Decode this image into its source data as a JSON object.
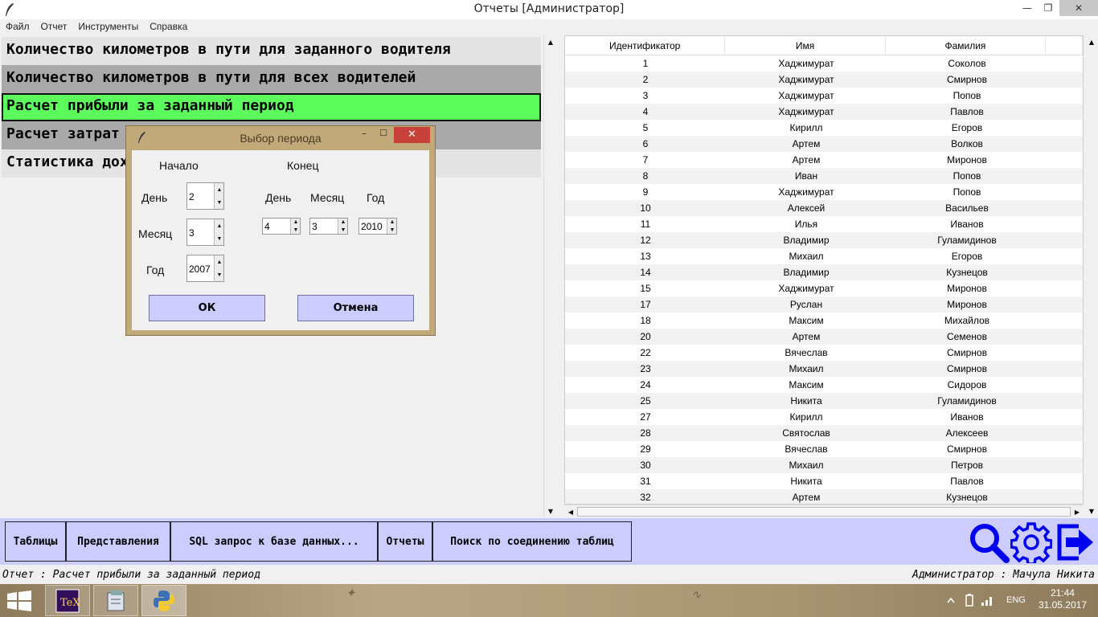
{
  "window": {
    "title": "Отчеты [Администратор]",
    "minimize_glyph": "—",
    "maximize_glyph": "❐",
    "close_glyph": "✕"
  },
  "menu": [
    "Файл",
    "Отчет",
    "Инструменты",
    "Справка"
  ],
  "reports": [
    {
      "label": "Количество километров в пути для заданного водителя",
      "state": "light"
    },
    {
      "label": "Количество километров в пути для всех водителей",
      "state": "dark"
    },
    {
      "label": "Расчет прибыли за заданный период",
      "state": "active"
    },
    {
      "label": "Расчет затрат на ремонт за заданный период",
      "state": "dark"
    },
    {
      "label": "Статистика доходов по водителям за все время",
      "state": "light"
    }
  ],
  "dialog": {
    "title": "Выбор периода",
    "min_glyph": "–",
    "max_glyph": "☐",
    "close_glyph": "✕",
    "start_label": "Начало",
    "end_label": "Конец",
    "day_label": "День",
    "month_label": "Месяц",
    "year_label": "Год",
    "start": {
      "day": "2",
      "month": "3",
      "year": "2007"
    },
    "end": {
      "day": "4",
      "month": "3",
      "year": "2010"
    },
    "ok_label": "ОК",
    "cancel_label": "Отмена"
  },
  "table": {
    "columns": [
      "Идентификатор",
      "Имя",
      "Фамилия"
    ],
    "rows": [
      [
        "1",
        "Хаджимурат",
        "Соколов"
      ],
      [
        "2",
        "Хаджимурат",
        "Смирнов"
      ],
      [
        "3",
        "Хаджимурат",
        "Попов"
      ],
      [
        "4",
        "Хаджимурат",
        "Павлов"
      ],
      [
        "5",
        "Кирилл",
        "Егоров"
      ],
      [
        "6",
        "Артем",
        "Волков"
      ],
      [
        "7",
        "Артем",
        "Миронов"
      ],
      [
        "8",
        "Иван",
        "Попов"
      ],
      [
        "9",
        "Хаджимурат",
        "Попов"
      ],
      [
        "10",
        "Алексей",
        "Васильев"
      ],
      [
        "11",
        "Илья",
        "Иванов"
      ],
      [
        "12",
        "Владимир",
        "Гуламидинов"
      ],
      [
        "13",
        "Михаил",
        "Егоров"
      ],
      [
        "14",
        "Владимир",
        "Кузнецов"
      ],
      [
        "15",
        "Хаджимурат",
        "Миронов"
      ],
      [
        "17",
        "Руслан",
        "Миронов"
      ],
      [
        "18",
        "Максим",
        "Михайлов"
      ],
      [
        "20",
        "Артем",
        "Семенов"
      ],
      [
        "22",
        "Вячеслав",
        "Смирнов"
      ],
      [
        "23",
        "Михаил",
        "Смирнов"
      ],
      [
        "24",
        "Максим",
        "Сидоров"
      ],
      [
        "25",
        "Никита",
        "Гуламидинов"
      ],
      [
        "27",
        "Кирилл",
        "Иванов"
      ],
      [
        "28",
        "Святослав",
        "Алексеев"
      ],
      [
        "29",
        "Вячеслав",
        "Смирнов"
      ],
      [
        "30",
        "Михаил",
        "Петров"
      ],
      [
        "31",
        "Никита",
        "Павлов"
      ],
      [
        "32",
        "Артем",
        "Кузнецов"
      ]
    ]
  },
  "toolbar": {
    "buttons": [
      "Таблицы",
      "Представления",
      "SQL запрос к базе данных...",
      "Отчеты",
      "Поиск по соединению таблиц"
    ],
    "icons": [
      "search-icon",
      "settings-gear-icon",
      "exit-icon"
    ],
    "icon_color": "#0000ee"
  },
  "status": {
    "left": "Отчет : Расчет прибыли за заданный период",
    "right": "Администратор : Мачула Никита"
  },
  "taskbar": {
    "time": "21:44",
    "date": "31.05.2017",
    "lang": "ENG",
    "apps": [
      "texworks-icon",
      "file-manager-icon",
      "python-icon"
    ]
  },
  "colors": {
    "active_report": "#5bfc5b",
    "toolbar_bg": "#ccccff",
    "dialog_frame": "#c1a97a",
    "close_red": "#c7403a"
  }
}
